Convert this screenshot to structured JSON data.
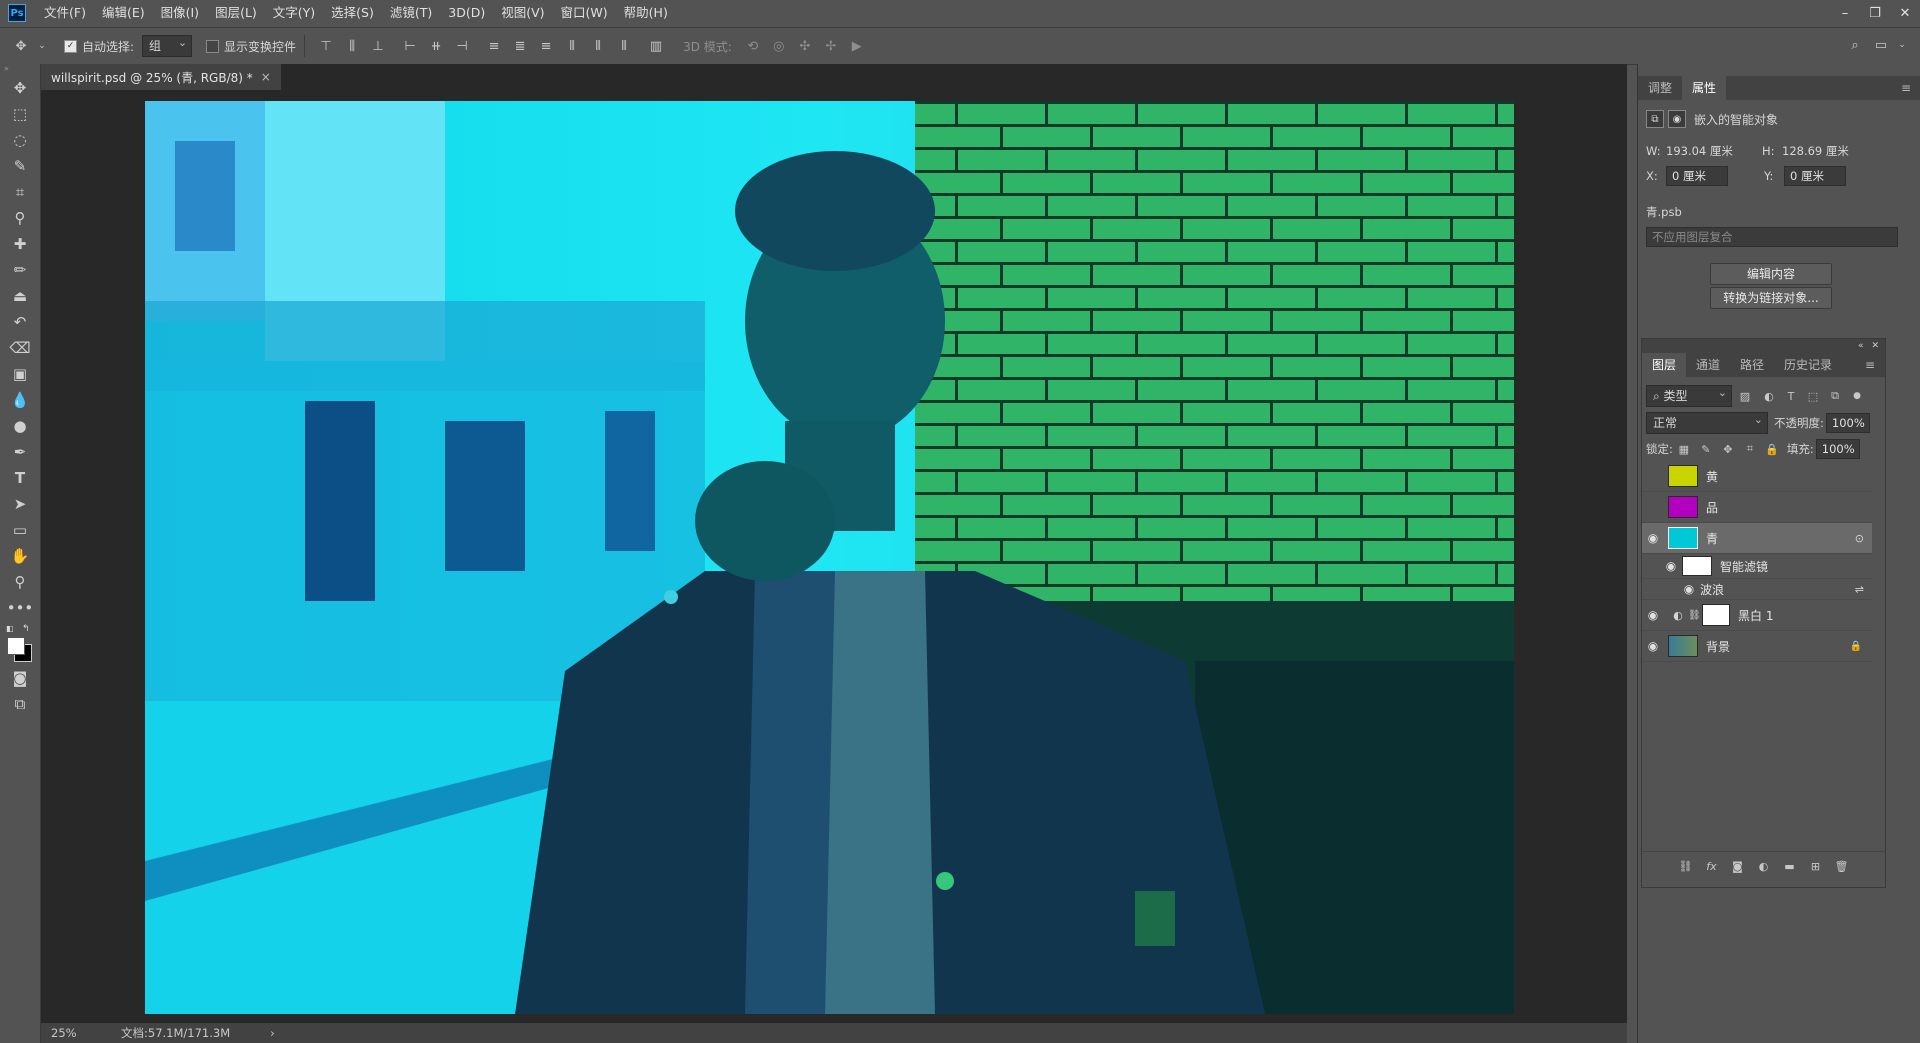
{
  "menubar": {
    "logo": "Ps",
    "items": [
      "文件(F)",
      "编辑(E)",
      "图像(I)",
      "图层(L)",
      "文字(Y)",
      "选择(S)",
      "滤镜(T)",
      "3D(D)",
      "视图(V)",
      "窗口(W)",
      "帮助(H)"
    ]
  },
  "options": {
    "auto_select_label": "自动选择:",
    "auto_select_value": "组",
    "show_transform_label": "显示变换控件",
    "mode_3d_label": "3D 模式:"
  },
  "document": {
    "tab_title": "willspirit.psd @ 25% (青, RGB/8) *",
    "tab_close": "×",
    "zoom": "25%",
    "doc_size": "文档:57.1M/171.3M",
    "status_arrow": "›"
  },
  "properties_panel": {
    "tabs": [
      "调整",
      "属性"
    ],
    "active_tab": "属性",
    "type_label": "嵌入的智能对象",
    "w_label": "W:",
    "w_value": "193.04 厘米",
    "h_label": "H:",
    "h_value": "128.69 厘米",
    "x_label": "X:",
    "x_value": "0 厘米",
    "y_label": "Y:",
    "y_value": "0 厘米",
    "filename": "青.psb",
    "comp_placeholder": "不应用图层复合",
    "edit_button": "编辑内容",
    "convert_button": "转换为链接对象..."
  },
  "layers_panel": {
    "tabs": [
      "图层",
      "通道",
      "路径",
      "历史记录"
    ],
    "active_tab": "图层",
    "filter_kind": "类型",
    "blend_mode": "正常",
    "opacity_label": "不透明度:",
    "opacity_value": "100%",
    "lock_label": "锁定:",
    "fill_label": "填充:",
    "fill_value": "100%",
    "layers": [
      {
        "name": "黄",
        "visible": false,
        "thumb_color": "#c9d400"
      },
      {
        "name": "品",
        "visible": false,
        "thumb_color": "#b300c0"
      },
      {
        "name": "青",
        "visible": true,
        "thumb_color": "#00c8d6",
        "selected": true
      },
      {
        "name": "智能滤镜",
        "visible": true,
        "sub": true
      },
      {
        "name": "波浪",
        "visible": true,
        "subsub": true
      },
      {
        "name": "黑白 1",
        "visible": true,
        "adjust": true
      },
      {
        "name": "背景",
        "visible": true,
        "locked": true,
        "thumb_color": "#4a6a80"
      }
    ]
  },
  "colors": {
    "ui_bg": "#535353",
    "dark_bg": "#282828",
    "accent": "#31a8ff",
    "cyan": "#00e5ee",
    "green": "#2fb06a"
  }
}
